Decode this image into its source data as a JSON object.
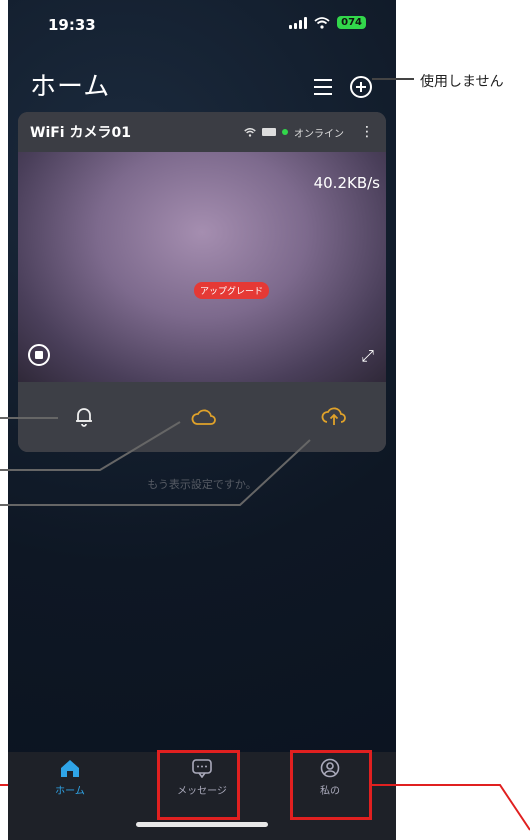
{
  "status_bar": {
    "time": "19:33",
    "battery": "074"
  },
  "header": {
    "title": "ホーム",
    "list_icon": "list-icon",
    "add_icon": "add-circle-icon"
  },
  "annotation": {
    "unused_label": "使用しません"
  },
  "camera_card": {
    "name": "WiFi カメラ01",
    "status_text": "オンライン",
    "speed": "40.2KB/s",
    "cloud_badge": "アップグレード"
  },
  "notice_text": "もう表示設定ですか。",
  "tab_bar": {
    "items": [
      {
        "label": "ホーム",
        "icon": "home-icon",
        "active": true
      },
      {
        "label": "メッセージ",
        "icon": "message-icon",
        "active": false
      },
      {
        "label": "私の",
        "icon": "profile-icon",
        "active": false
      }
    ]
  },
  "colors": {
    "accent": "#2fa4e7",
    "highlight": "#e02020",
    "cloud": "#e0a22a"
  }
}
